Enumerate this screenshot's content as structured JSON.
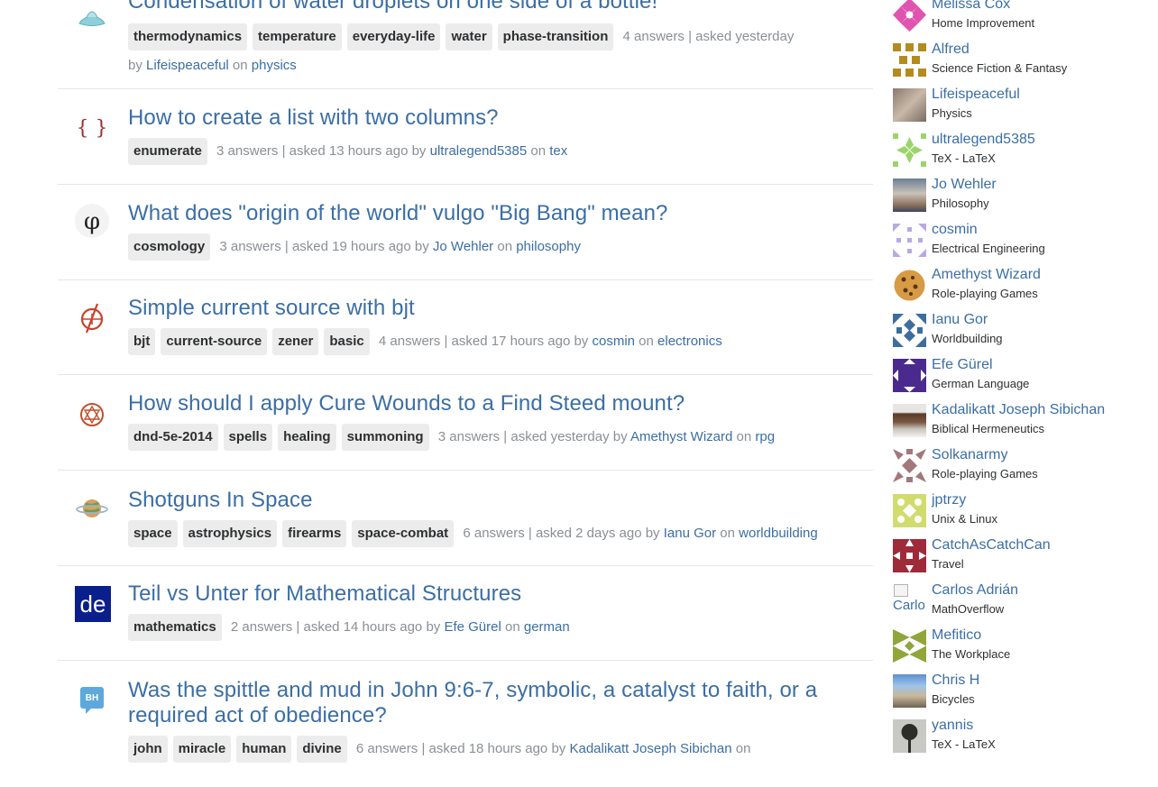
{
  "questions": [
    {
      "title": "Condensation of water droplets on one side of a bottle!",
      "tags": [
        "thermodynamics",
        "temperature",
        "everyday-life",
        "water",
        "phase-transition"
      ],
      "answers": "4 answers",
      "asked": "asked yesterday",
      "user": "Lifeispeaceful",
      "site": "physics",
      "icon": "physics-site-icon"
    },
    {
      "title": "How to create a list with two columns?",
      "tags": [
        "enumerate"
      ],
      "answers": "3 answers",
      "asked": "asked 13 hours ago",
      "user": "ultralegend5385",
      "site": "tex",
      "icon": "tex-site-icon"
    },
    {
      "title": "What does \"origin of the world\" vulgo \"Big Bang\" mean?",
      "tags": [
        "cosmology"
      ],
      "answers": "3 answers",
      "asked": "asked 19 hours ago",
      "user": "Jo Wehler",
      "site": "philosophy",
      "icon": "philosophy-site-icon"
    },
    {
      "title": "Simple current source with bjt",
      "tags": [
        "bjt",
        "current-source",
        "zener",
        "basic"
      ],
      "answers": "4 answers",
      "asked": "asked 17 hours ago",
      "user": "cosmin",
      "site": "electronics",
      "icon": "electronics-site-icon"
    },
    {
      "title": "How should I apply Cure Wounds to a Find Steed mount?",
      "tags": [
        "dnd-5e-2014",
        "spells",
        "healing",
        "summoning"
      ],
      "answers": "3 answers",
      "asked": "asked yesterday",
      "user": "Amethyst Wizard",
      "site": "rpg",
      "icon": "rpg-site-icon"
    },
    {
      "title": "Shotguns In Space",
      "tags": [
        "space",
        "astrophysics",
        "firearms",
        "space-combat"
      ],
      "answers": "6 answers",
      "asked": "asked 2 days ago",
      "user": "Ianu Gor",
      "site": "worldbuilding",
      "icon": "worldbuilding-site-icon"
    },
    {
      "title": "Teil vs Unter for Mathematical Structures",
      "tags": [
        "mathematics"
      ],
      "answers": "2 answers",
      "asked": "asked 14 hours ago",
      "user": "Efe Gürel",
      "site": "german",
      "icon": "german-site-icon",
      "icon_text": "de"
    },
    {
      "title": "Was the spittle and mud in John 9:6-7, symbolic, a catalyst to faith, or a required act of obedience?",
      "tags": [
        "john",
        "miracle",
        "human",
        "divine"
      ],
      "answers": "6 answers",
      "asked": "asked 18 hours ago",
      "user": "Kadalikatt Joseph Sibichan",
      "site": "",
      "icon": "hermeneutics-site-icon",
      "icon_text": "BH"
    }
  ],
  "meta_sep": " | ",
  "by_word": "by",
  "on_word": "on",
  "users": [
    {
      "name": "Melissa Cox",
      "site": "Home Improvement"
    },
    {
      "name": "Alfred",
      "site": "Science Fiction & Fantasy"
    },
    {
      "name": "Lifeispeaceful",
      "site": "Physics"
    },
    {
      "name": "ultralegend5385",
      "site": "TeX - LaTeX"
    },
    {
      "name": "Jo Wehler",
      "site": "Philosophy"
    },
    {
      "name": "cosmin",
      "site": "Electrical Engineering"
    },
    {
      "name": "Amethyst Wizard",
      "site": "Role-playing Games"
    },
    {
      "name": "Ianu Gor",
      "site": "Worldbuilding"
    },
    {
      "name": "Efe Gürel",
      "site": "German Language"
    },
    {
      "name": "Kadalikatt Joseph Sibichan",
      "site": "Biblical Hermeneutics"
    },
    {
      "name": "Solkanarmy",
      "site": "Role-playing Games"
    },
    {
      "name": "jptrzy",
      "site": "Unix & Linux"
    },
    {
      "name": "CatchAsCatchCan",
      "site": "Travel"
    },
    {
      "name": "Carlos Adrián",
      "site": "MathOverflow",
      "broken_alt": "Carlo"
    },
    {
      "name": "Mefitico",
      "site": "The Workplace"
    },
    {
      "name": "Chris H",
      "site": "Bicycles"
    },
    {
      "name": "yannis",
      "site": "TeX - LaTeX"
    }
  ],
  "colors": {
    "link": "#3b6ea5",
    "tag_bg": "#ececec",
    "meta": "#8b8f93",
    "divider": "#e4e6e8"
  }
}
